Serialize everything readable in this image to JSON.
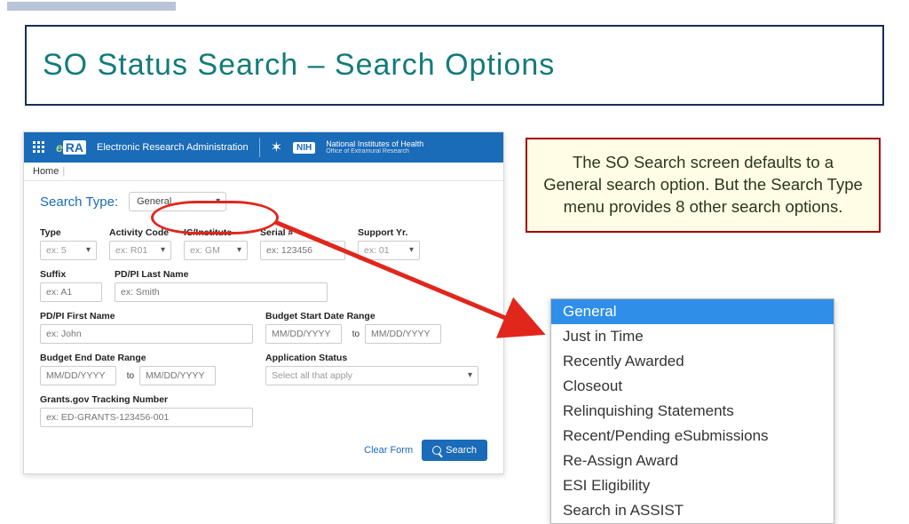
{
  "slide": {
    "title": "SO Status Search – Search Options"
  },
  "app": {
    "brand_text": "Electronic Research Administration",
    "nih_label": "NIH",
    "nih_text": "National Institutes of Health",
    "nih_sub": "Office of Extramural Research",
    "home_label": "Home"
  },
  "search_type": {
    "label": "Search Type:",
    "value": "General"
  },
  "fields": {
    "type": {
      "label": "Type",
      "placeholder": "ex: 5"
    },
    "activity_code": {
      "label": "Activity Code",
      "placeholder": "ex: R01"
    },
    "ic": {
      "label": "IC/Institute",
      "placeholder": "ex: GM"
    },
    "serial": {
      "label": "Serial #",
      "placeholder": "ex: 123456"
    },
    "support_yr": {
      "label": "Support Yr.",
      "placeholder": "ex: 01"
    },
    "suffix": {
      "label": "Suffix",
      "placeholder": "ex: A1"
    },
    "last_name": {
      "label": "PD/PI Last Name",
      "placeholder": "ex: Smith"
    },
    "first_name": {
      "label": "PD/PI First Name",
      "placeholder": "ex: John"
    },
    "budget_start": {
      "label": "Budget Start Date Range",
      "placeholder": "MM/DD/YYYY"
    },
    "budget_end": {
      "label": "Budget End Date Range",
      "placeholder": "MM/DD/YYYY"
    },
    "to": "to",
    "app_status": {
      "label": "Application Status",
      "placeholder": "Select all that apply"
    },
    "tracking": {
      "label": "Grants.gov Tracking Number",
      "placeholder": "ex: ED-GRANTS-123456-001"
    }
  },
  "actions": {
    "clear": "Clear Form",
    "search": "Search"
  },
  "callout": "The SO Search screen defaults to a General search option. But the Search Type menu provides 8 other search options.",
  "dropdown": {
    "items": [
      "General",
      "Just in Time",
      "Recently Awarded",
      "Closeout",
      "Relinquishing Statements",
      "Recent/Pending eSubmissions",
      "Re-Assign Award",
      "ESI Eligibility",
      "Search in ASSIST"
    ]
  }
}
